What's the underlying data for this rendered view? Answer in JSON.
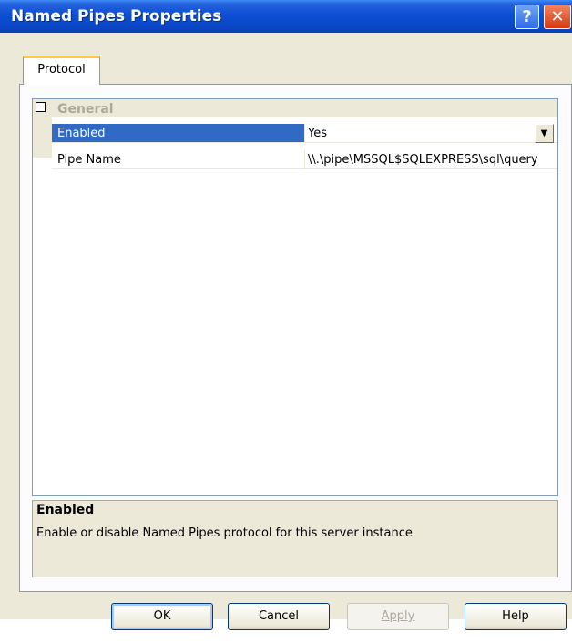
{
  "window": {
    "title": "Named Pipes Properties",
    "help_glyph": "?",
    "close_glyph": "✕"
  },
  "tabs": [
    {
      "label": "Protocol"
    }
  ],
  "grid": {
    "category": {
      "toggle_glyph": "⊟",
      "label": "General"
    },
    "properties": [
      {
        "name": "Enabled",
        "value": "Yes",
        "selected": true
      },
      {
        "name": "Pipe Name",
        "value": "\\\\.\\pipe\\MSSQL$SQLEXPRESS\\sql\\query",
        "selected": false
      }
    ],
    "dropdown_glyph": "▼"
  },
  "description": {
    "title": "Enabled",
    "text": "Enable or disable Named Pipes protocol for this server instance"
  },
  "buttons": {
    "ok": "OK",
    "cancel": "Cancel",
    "apply": "Apply",
    "help": "Help"
  },
  "colors": {
    "title_bar": "#0a48c8",
    "selection": "#316ac5",
    "dialog_face": "#ece9d8"
  }
}
